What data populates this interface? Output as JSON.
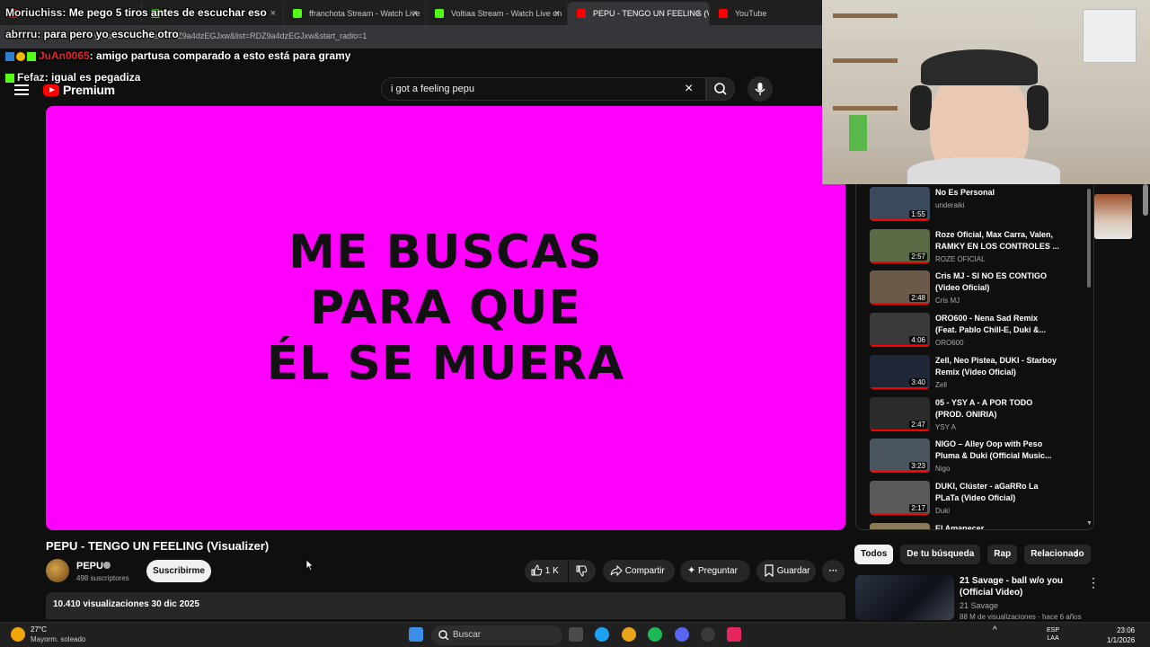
{
  "browser": {
    "tabs": [
      {
        "label": "Mor",
        "icon_color": "#ff0000",
        "active": false
      },
      {
        "label": "",
        "icon_color": "#53fc18",
        "active": false
      },
      {
        "label": "ffranchota Stream - Watch Live",
        "icon_color": "#53fc18",
        "active": false
      },
      {
        "label": "Voltiaa Stream - Watch Live on",
        "icon_color": "#53fc18",
        "active": false
      },
      {
        "label": "PEPU - TENGO UN FEELING (Vi",
        "icon_color": "#ff0000",
        "active": true
      },
      {
        "label": "YouTube",
        "icon_color": "#ff0000",
        "active": false
      }
    ],
    "close_glyph": "×",
    "url": "youtube.com/watch?v=Z9a4dzEGJxw&list=RDZ9a4dzEGJxw&start_radio=1"
  },
  "chat": [
    {
      "user": "Moriuchiss",
      "message": ": Me pego 5 tiros antes de escuchar eso",
      "user_color": "#e8e8e8"
    },
    {
      "user": "abrrru",
      "message": ": para pero yo escuche otro",
      "user_color": "#e8e8e8"
    },
    {
      "user": "JuAn0065",
      "message": ": amigo partusa comparado a esto está para gramy",
      "user_color": "#e0252d"
    },
    {
      "user": "Fefaz",
      "message": ": igual es pegadiza",
      "user_color": "#e8e8e8"
    }
  ],
  "youtube": {
    "logo_text": "Premium",
    "search_value": "i got a feeling pepu",
    "clear_glyph": "×",
    "video": {
      "background_color": "#ff00ff",
      "lyrics": [
        "ME BUSCAS",
        "PARA QUE",
        "ÉL SE MUERA"
      ]
    },
    "title": "PEPU - TENGO UN FEELING (Visualizer)",
    "channel": "PEPU",
    "subscribers": "498 suscriptores",
    "subscribe_label": "Suscribirme",
    "likes": "1 K",
    "share_label": "Compartir",
    "ask_label": "Preguntar",
    "save_label": "Guardar",
    "more_glyph": "···",
    "views_date": "10.410 visualizaciones  30 dic 2025"
  },
  "playlist": [
    {
      "title": "No Es Personal",
      "channel": "underaiki",
      "duration": "1:55",
      "thumb": "#3b4a5c"
    },
    {
      "title": "Roze Oficial, Max Carra, Valen, RAMKY EN LOS CONTROLES ...",
      "channel": "ROZE OFICIAL",
      "duration": "2:57",
      "thumb": "#5a6a44"
    },
    {
      "title": "Cris MJ - SI NO ES CONTIGO (Video Oficial)",
      "channel": "Cris MJ",
      "duration": "2:48",
      "thumb": "#6b5a4a"
    },
    {
      "title": "ORO600 - Nena Sad Remix (Feat. Pablo Chill-E, Duki &...",
      "channel": "ORO600",
      "duration": "4:06",
      "thumb": "#3a3a3a"
    },
    {
      "title": "Zell, Neo Pistea, DUKI - Starboy Remix (Video Oficial)",
      "channel": "Zell",
      "duration": "3:40",
      "thumb": "#1f2636"
    },
    {
      "title": "05 - YSY A - A POR TODO (PROD. ONIRIA)",
      "channel": "YSY A",
      "duration": "2:47",
      "thumb": "#2b2b2b"
    },
    {
      "title": "NIGO – Alley Oop with Peso Pluma & Duki (Official Music...",
      "channel": "Nigo",
      "duration": "3:23",
      "thumb": "#4a5560"
    },
    {
      "title": "DUKI, Clúster - aGaRRo La PLaTa (Video Oficial)",
      "channel": "Duki",
      "duration": "2:17",
      "thumb": "#5a5a5a"
    },
    {
      "title": "El Amanecer",
      "channel": "",
      "duration": "",
      "thumb": "#8a7a5a"
    }
  ],
  "chips": [
    {
      "label": "Todos",
      "active": true
    },
    {
      "label": "De tu búsqueda",
      "active": false
    },
    {
      "label": "Rap",
      "active": false
    },
    {
      "label": "Relacionado",
      "active": false
    }
  ],
  "recommendation": {
    "title": "21 Savage - ball w/o you (Official Video)",
    "channel": "21 Savage",
    "meta": "88 M de visualizaciones · hace 6 años"
  },
  "taskbar": {
    "temp": "27°C",
    "weather": "Mayorm. soleado",
    "search_label": "Buscar",
    "lang_top": "ESP",
    "lang_bottom": "LAA",
    "time": "23:06",
    "date": "1/1/2026"
  }
}
